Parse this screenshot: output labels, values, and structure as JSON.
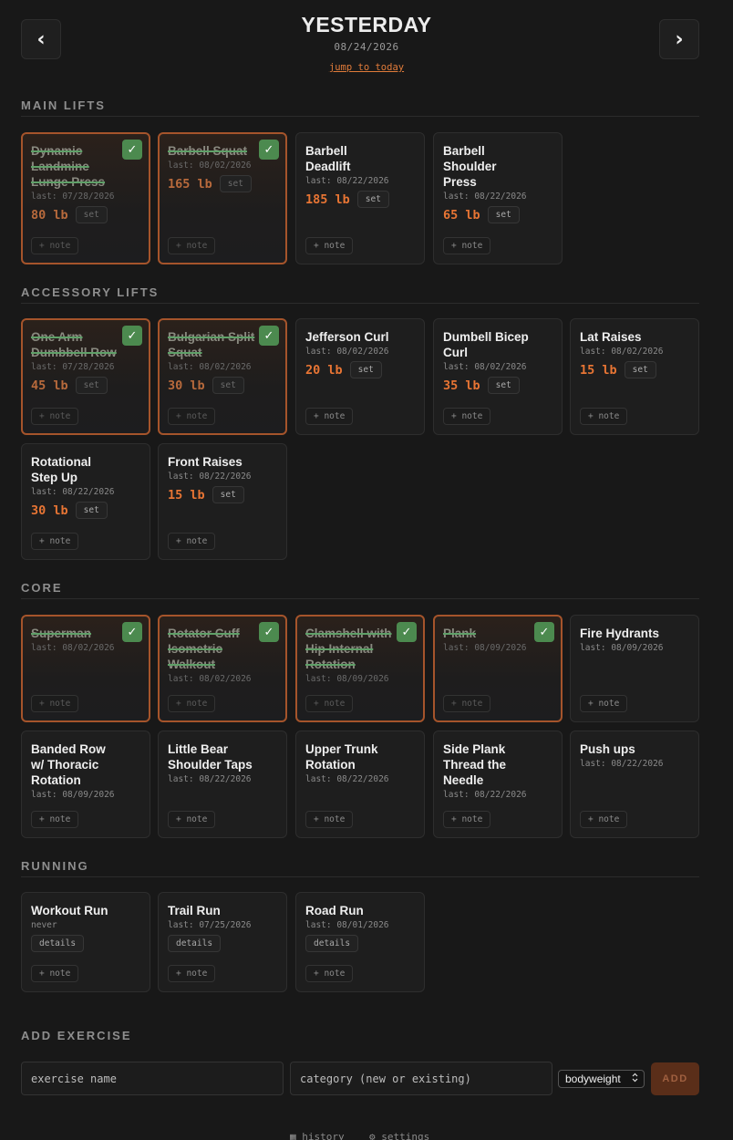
{
  "header": {
    "prev_label": "‹",
    "next_label": "›",
    "title": "YESTERDAY",
    "date": "08/24/2026",
    "jump_label": "jump to today"
  },
  "sections": [
    {
      "title": "MAIN LIFTS",
      "cards": [
        {
          "name": "Dynamic Landmine Lunge Press",
          "last": "last: 07/28/2026",
          "weight": "80 lb",
          "set": "set",
          "note": "+ note",
          "done": true
        },
        {
          "name": "Barbell Squat",
          "last": "last: 08/02/2026",
          "weight": "165 lb",
          "set": "set",
          "note": "+ note",
          "done": true
        },
        {
          "name": "Barbell Deadlift",
          "last": "last: 08/22/2026",
          "weight": "185 lb",
          "set": "set",
          "note": "+ note",
          "done": false
        },
        {
          "name": "Barbell Shoulder Press",
          "last": "last: 08/22/2026",
          "weight": "65 lb",
          "set": "set",
          "note": "+ note",
          "done": false
        }
      ]
    },
    {
      "title": "ACCESSORY LIFTS",
      "cards": [
        {
          "name": "One Arm Dumbbell Row",
          "last": "last: 07/28/2026",
          "weight": "45 lb",
          "set": "set",
          "note": "+ note",
          "done": true
        },
        {
          "name": "Bulgarian Split Squat",
          "last": "last: 08/02/2026",
          "weight": "30 lb",
          "set": "set",
          "note": "+ note",
          "done": true
        },
        {
          "name": "Jefferson Curl",
          "last": "last: 08/02/2026",
          "weight": "20 lb",
          "set": "set",
          "note": "+ note",
          "done": false
        },
        {
          "name": "Dumbell Bicep Curl",
          "last": "last: 08/02/2026",
          "weight": "35 lb",
          "set": "set",
          "note": "+ note",
          "done": false
        },
        {
          "name": "Lat Raises",
          "last": "last: 08/02/2026",
          "weight": "15 lb",
          "set": "set",
          "note": "+ note",
          "done": false
        },
        {
          "name": "Rotational Step Up",
          "last": "last: 08/22/2026",
          "weight": "30 lb",
          "set": "set",
          "note": "+ note",
          "done": false
        },
        {
          "name": "Front Raises",
          "last": "last: 08/22/2026",
          "weight": "15 lb",
          "set": "set",
          "note": "+ note",
          "done": false
        }
      ]
    },
    {
      "title": "CORE",
      "cards": [
        {
          "name": "Superman",
          "last": "last: 08/02/2026",
          "note": "+ note",
          "done": true
        },
        {
          "name": "Rotator Cuff Isometric Walkout",
          "last": "last: 08/02/2026",
          "note": "+ note",
          "done": true
        },
        {
          "name": "Clamshell with Hip Internal Rotation",
          "last": "last: 08/09/2026",
          "note": "+ note",
          "done": true
        },
        {
          "name": "Plank",
          "last": "last: 08/09/2026",
          "note": "+ note",
          "done": true
        },
        {
          "name": "Fire Hydrants",
          "last": "last: 08/09/2026",
          "note": "+ note",
          "done": false
        },
        {
          "name": "Banded Row w/ Thoracic Rotation",
          "last": "last: 08/09/2026",
          "note": "+ note",
          "done": false
        },
        {
          "name": "Little Bear Shoulder Taps",
          "last": "last: 08/22/2026",
          "note": "+ note",
          "done": false
        },
        {
          "name": "Upper Trunk Rotation",
          "last": "last: 08/22/2026",
          "note": "+ note",
          "done": false
        },
        {
          "name": "Side Plank Thread the Needle",
          "last": "last: 08/22/2026",
          "note": "+ note",
          "done": false
        },
        {
          "name": "Push ups",
          "last": "last: 08/22/2026",
          "note": "+ note",
          "done": false
        }
      ]
    },
    {
      "title": "RUNNING",
      "cards": [
        {
          "name": "Workout Run",
          "last": "never",
          "details": "details",
          "note": "+ note",
          "done": false
        },
        {
          "name": "Trail Run",
          "last": "last: 07/25/2026",
          "details": "details",
          "note": "+ note",
          "done": false
        },
        {
          "name": "Road Run",
          "last": "last: 08/01/2026",
          "details": "details",
          "note": "+ note",
          "done": false
        }
      ]
    }
  ],
  "add_exercise": {
    "title": "ADD EXERCISE",
    "name_placeholder": "exercise name",
    "category_placeholder": "category (new or existing)",
    "type_value": "bodyweight",
    "add_label": "ADD"
  },
  "footer": {
    "history_label": "▦ history",
    "settings_label": "⚙ settings"
  },
  "icons": {
    "check": "check-icon",
    "updown": "updown-chevron-icon"
  },
  "colors": {
    "accent": "#e87534",
    "done_border": "#a5542b",
    "check_bg": "#4c8a4f"
  }
}
